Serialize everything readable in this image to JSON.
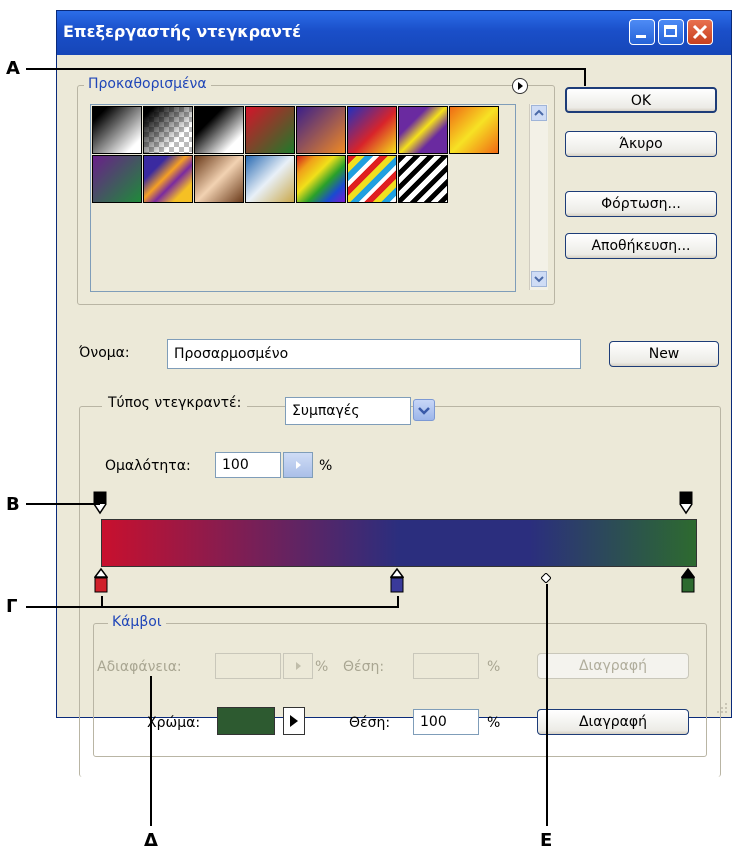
{
  "window": {
    "title": "Επεξεργαστής ντεγκραντέ",
    "controls": [
      "minimize-icon",
      "maximize-icon",
      "close-icon"
    ]
  },
  "presets": {
    "legend": "Προκαθορισμένα",
    "menu_icon": "circle-arrow-icon",
    "swatches_row1": [
      "black-white",
      "transparent-checker",
      "black-white-dark",
      "red-green",
      "purple-orange",
      "blue-red-yellow",
      "yellow-violet",
      "orange-yellow"
    ],
    "swatches_row2": [
      "purple-green",
      "violet-orange",
      "copper",
      "chrome",
      "spectrum",
      "transparent-rainbow",
      "stripes"
    ]
  },
  "buttons": {
    "ok": "OK",
    "cancel": "Άκυρο",
    "load": "Φόρτωση...",
    "save": "Αποθήκευση...",
    "new": "New"
  },
  "name": {
    "label": "Όνομα:",
    "value": "Προσαρμοσμένο"
  },
  "gradient_type": {
    "label": "Τύπος ντεγκραντέ:",
    "value": "Συμπαγές"
  },
  "smoothness": {
    "label": "Ομαλότητα:",
    "value": "100",
    "unit": "%"
  },
  "gradient": {
    "colors": [
      "#c8102e",
      "#2b2e7e",
      "#2d6a2f"
    ]
  },
  "stops": {
    "legend": "Κάμβοι",
    "opacity_label": "Αδιαφάνεια:",
    "opacity_unit": "%",
    "location_label_disabled": "Θέση:",
    "location_unit_disabled": "%",
    "delete_disabled": "Διαγραφή",
    "color_label": "Χρώμα:",
    "color_value": "#2d5a30",
    "location_label": "Θέση:",
    "location_value": "100",
    "location_unit": "%",
    "delete": "Διαγραφή"
  },
  "callouts": [
    "A",
    "B",
    "Γ",
    "Δ",
    "E"
  ]
}
